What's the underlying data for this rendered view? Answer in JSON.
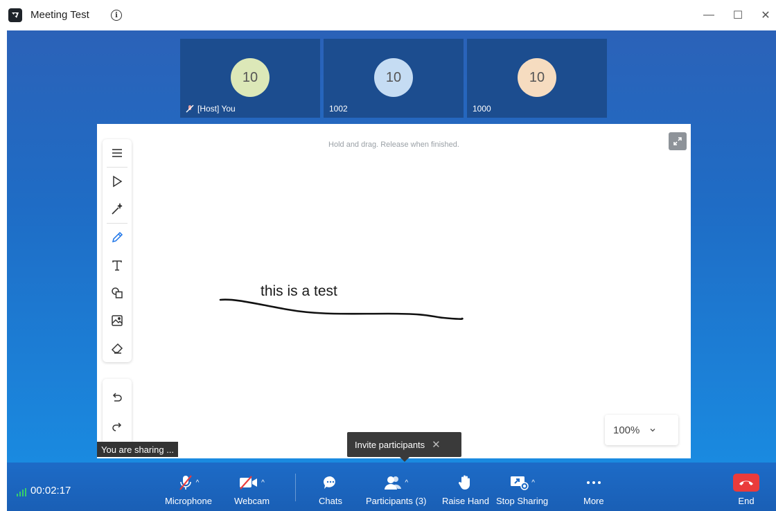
{
  "window": {
    "title": "Meeting Test",
    "controls": {
      "minimize": "—",
      "maximize": "☐",
      "close": "✕"
    }
  },
  "participants": [
    {
      "avatar_text": "10",
      "name": "[Host] You",
      "avatar_color": "#dce8b8",
      "muted": true
    },
    {
      "avatar_text": "10",
      "name": "1002",
      "avatar_color": "#c5dcf3",
      "muted": false
    },
    {
      "avatar_text": "10",
      "name": "1000",
      "avatar_color": "#f6dcc0",
      "muted": false
    }
  ],
  "whiteboard": {
    "hint": "Hold and drag. Release when finished.",
    "text": "this is a test",
    "zoom": "100%",
    "tools": [
      "menu",
      "select",
      "laser",
      "pen",
      "text",
      "shapes",
      "image",
      "eraser",
      "undo",
      "redo"
    ],
    "active_tool": "pen"
  },
  "sharing_badge": "You are sharing ...",
  "invite_tooltip": {
    "label": "Invite participants",
    "close": "✕"
  },
  "bottombar": {
    "timer": "00:02:17",
    "controls": {
      "microphone": "Microphone",
      "webcam": "Webcam",
      "chats": "Chats",
      "participants": "Participants (3)",
      "raise_hand": "Raise Hand",
      "stop_sharing": "Stop Sharing",
      "more": "More",
      "end": "End"
    }
  },
  "colors": {
    "accent": "#1a6fd0",
    "end": "#ea3b3b",
    "signal": "#38d06a"
  }
}
